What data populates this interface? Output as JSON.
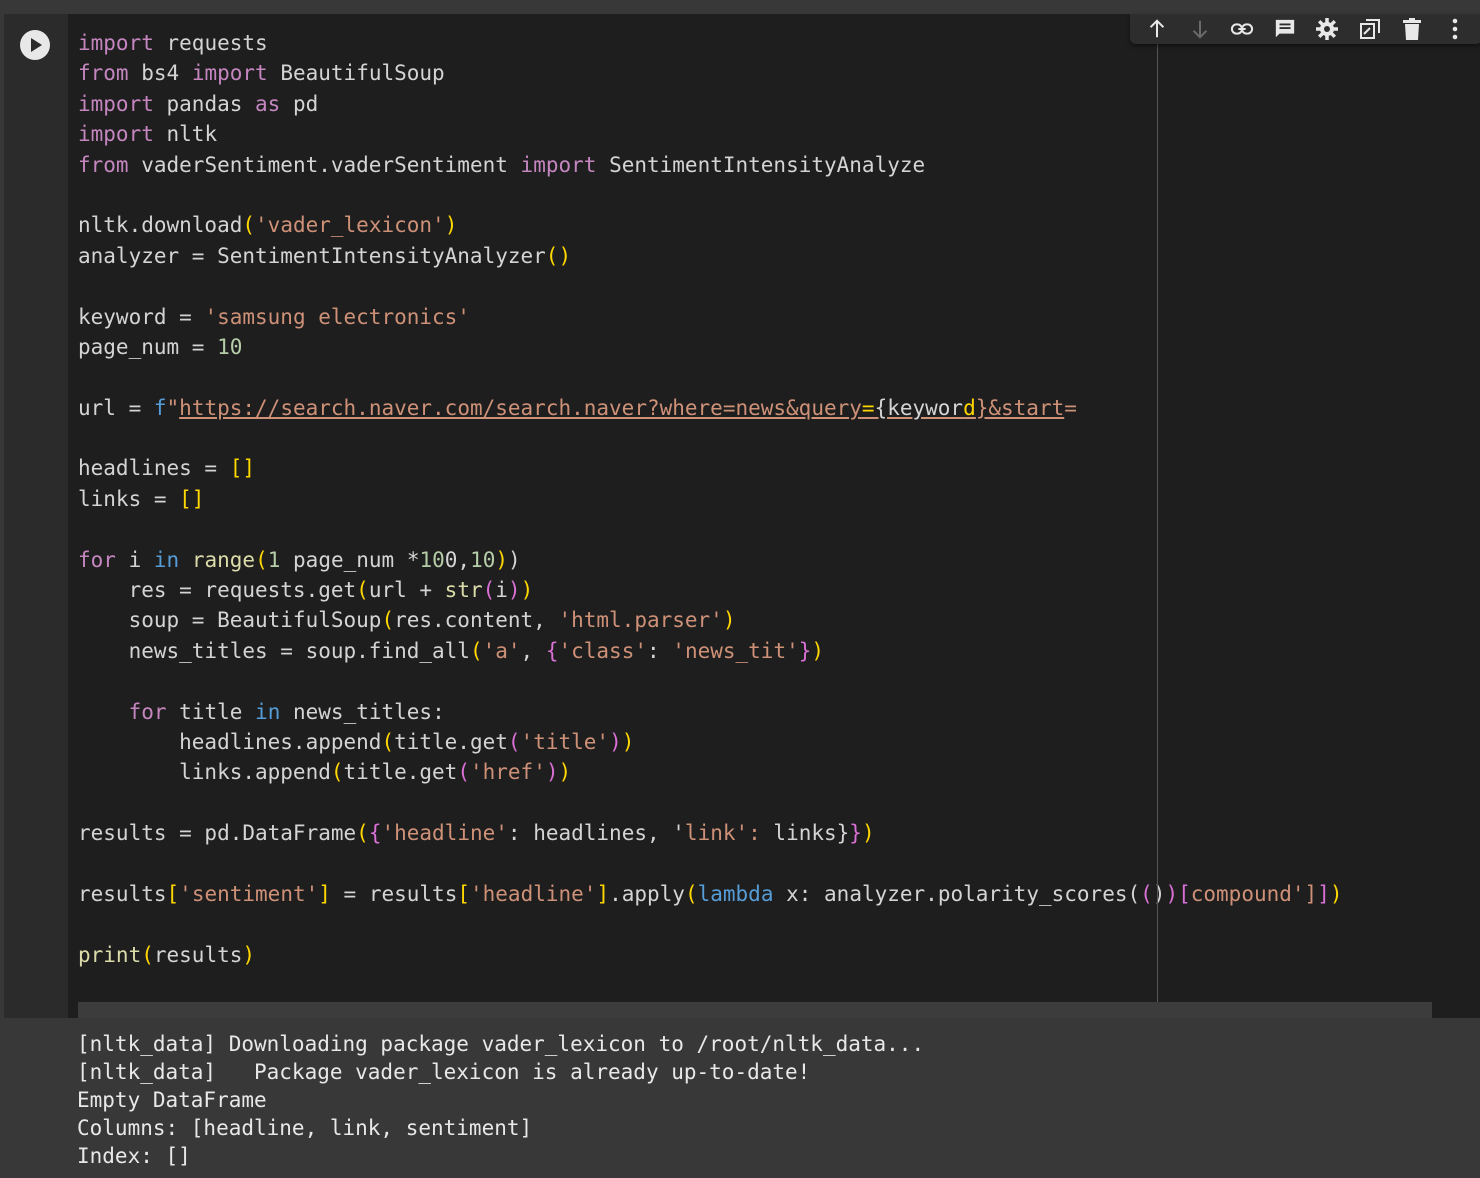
{
  "code_lines": [
    "import requests",
    "from bs4 import BeautifulSoup",
    "import pandas as pd",
    "import nltk",
    "from vaderSentiment.vaderSentiment import SentimentIntensityAnalyzer",
    "",
    "nltk.download('vader_lexicon')",
    "analyzer = SentimentIntensityAnalyzer()",
    "",
    "keyword = 'samsung electronics'",
    "page_num = 10",
    "",
    "url = f\"https://search.naver.com/search.naver?where=news&query={keyword}&start=\"",
    "",
    "headlines = []",
    "links = []",
    "",
    "for i in range(1, page_num * 10, 10):",
    "    res = requests.get(url + str(i))",
    "    soup = BeautifulSoup(res.content, 'html.parser')",
    "    news_titles = soup.find_all('a', {'class': 'news_tit'})",
    "",
    "    for title in news_titles:",
    "        headlines.append(title.get('title'))",
    "        links.append(title.get('href'))",
    "",
    "results = pd.DataFrame({'headline': headlines, 'link': links})",
    "",
    "results['sentiment'] = results['headline'].apply(lambda x: analyzer.polarity_scores(x)['compound'])",
    "",
    "print(results)"
  ],
  "output_lines": [
    "[nltk_data] Downloading package vader_lexicon to /root/nltk_data...",
    "[nltk_data]   Package vader_lexicon is already up-to-date!",
    "Empty DataFrame",
    "Columns: [headline, link, sentiment]",
    "Index: []"
  ],
  "toolbar": [
    {
      "name": "move-up-icon"
    },
    {
      "name": "move-down-icon"
    },
    {
      "name": "link-icon"
    },
    {
      "name": "comment-icon"
    },
    {
      "name": "settings-icon"
    },
    {
      "name": "mirror-cell-icon"
    },
    {
      "name": "delete-icon"
    },
    {
      "name": "more-options-icon"
    }
  ],
  "colors": {
    "keyword": "#c586c0",
    "builtin": "#569cd6",
    "string": "#ce9178",
    "number": "#b5cea8",
    "function": "#dcdcaa",
    "bracket_1": "#ffd700",
    "bracket_2": "#da70d6",
    "bracket_3": "#179fff",
    "text": "#d4d4d4",
    "editor_bg": "#1e1e1e",
    "output_bg": "#383838"
  }
}
